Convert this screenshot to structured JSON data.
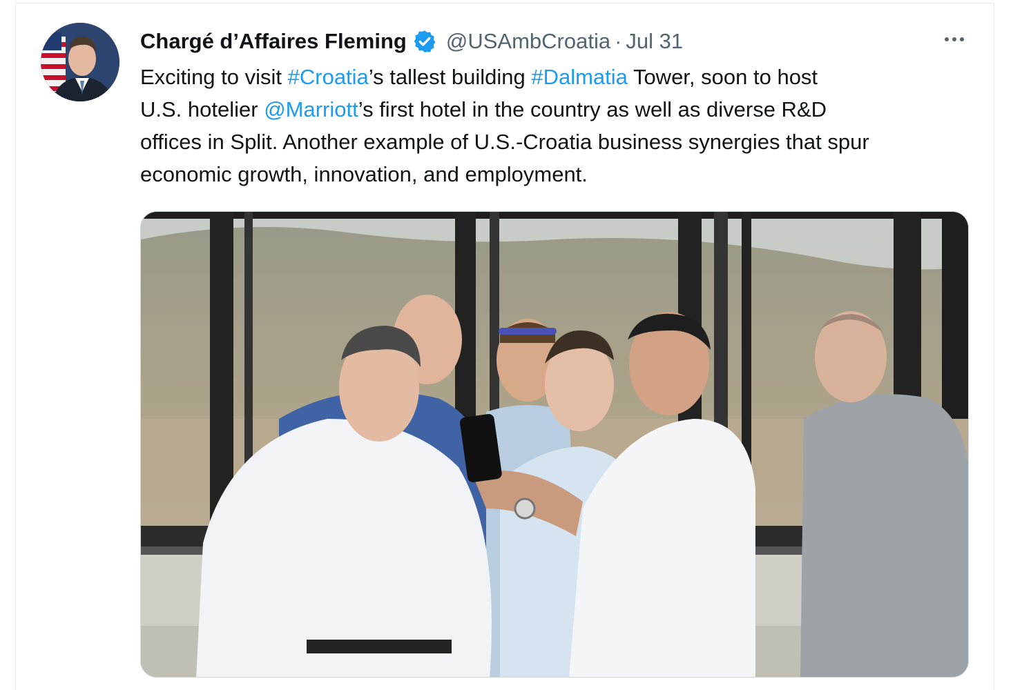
{
  "tweet": {
    "author_name": "Chargé d’Affaires Fleming",
    "verified_icon": "verified-badge-icon",
    "handle": "@USAmbCroatia",
    "separator": "·",
    "date": "Jul 31",
    "more_icon": "more-options-icon",
    "text": {
      "l1_a": "Exciting to visit ",
      "l1_tag1": "#Croatia",
      "l1_b": "’s tallest building ",
      "l1_tag2": "#Dalmatia",
      "l1_c": " Tower, soon to host",
      "l2_a": "U.S. hotelier ",
      "l2_mention": "@Marriott",
      "l2_b": "’s first hotel in the country as well as diverse R&D",
      "l3": "offices in Split. Another example of U.S.-Croatia business synergies that spur",
      "l4": "economic growth, innovation, and employment."
    },
    "media_description_icon": "photo-image"
  },
  "colors": {
    "link": "#1d9bf0",
    "text": "#0f1419",
    "secondary": "#536471",
    "verified": "#1d9bf0"
  }
}
